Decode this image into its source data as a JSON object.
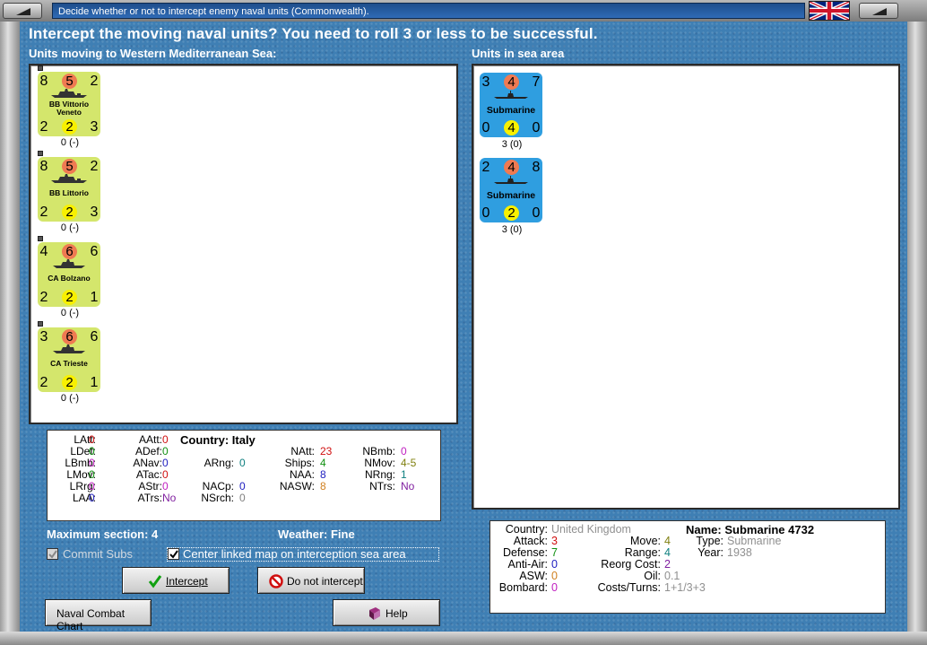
{
  "window": {
    "title": "Decide whether or not to intercept enemy naval units (Commonwealth)."
  },
  "dialog": {
    "headline": "Intercept the moving naval units?  You need to roll 3 or less to be successful.",
    "left_label": "Units moving to Western Mediterranean Sea:",
    "right_label": "Units in sea area"
  },
  "moving_units": [
    {
      "tl": "8",
      "circle": "5",
      "tr": "2",
      "name": "BB Vittorio Veneto",
      "bl": "2",
      "yellow": "2",
      "br": "3",
      "status": "0 (-)"
    },
    {
      "tl": "8",
      "circle": "5",
      "tr": "2",
      "name": "BB Littorio",
      "bl": "2",
      "yellow": "2",
      "br": "3",
      "status": "0 (-)"
    },
    {
      "tl": "4",
      "circle": "6",
      "tr": "6",
      "name": "CA Bolzano",
      "bl": "2",
      "yellow": "2",
      "br": "1",
      "status": "0 (-)"
    },
    {
      "tl": "3",
      "circle": "6",
      "tr": "6",
      "name": "CA Trieste",
      "bl": "2",
      "yellow": "2",
      "br": "1",
      "status": "0 (-)"
    }
  ],
  "sea_units": [
    {
      "tl": "3",
      "circle": "4",
      "tr": "7",
      "name": "Submarine",
      "bl": "0",
      "yellow": "4",
      "br": "0",
      "status": "3 (0)"
    },
    {
      "tl": "2",
      "circle": "4",
      "tr": "8",
      "name": "Submarine",
      "bl": "0",
      "yellow": "2",
      "br": "0",
      "status": "3 (0)"
    }
  ],
  "stats": {
    "country_label": "Country: Italy",
    "col1": [
      {
        "label": "LAtt:",
        "value": "0",
        "color": "#d01010"
      },
      {
        "label": "LDef:",
        "value": "0",
        "color": "#109010"
      },
      {
        "label": "LBmb:",
        "value": "0",
        "color": "#c020c0"
      },
      {
        "label": "LMov:",
        "value": "0",
        "color": "#109010"
      },
      {
        "label": "LRrg:",
        "value": "0",
        "color": "#c020c0"
      },
      {
        "label": "LAA:",
        "value": "0",
        "color": "#2020c0"
      }
    ],
    "col2": [
      {
        "label": "AAtt:",
        "value": "0",
        "color": "#d01010"
      },
      {
        "label": "ADef:",
        "value": "0",
        "color": "#109010"
      },
      {
        "label": "ANav:",
        "value": "0",
        "color": "#2020c0"
      },
      {
        "label": "ATac:",
        "value": "0",
        "color": "#d01010"
      },
      {
        "label": "AStr:",
        "value": "0",
        "color": "#c020c0"
      },
      {
        "label": "ATrs:",
        "value": "No",
        "color": "#8020a0"
      }
    ],
    "col3": [
      {
        "label": "ARng:",
        "value": "0",
        "color": "#108080"
      },
      {
        "label": "NACp:",
        "value": "0",
        "color": "#2020c0"
      },
      {
        "label": "NSrch:",
        "value": "0",
        "color": "#808080"
      }
    ],
    "col4": [
      {
        "label": "NAtt:",
        "value": "23",
        "color": "#d01010"
      },
      {
        "label": "Ships:",
        "value": "4",
        "color": "#109010"
      },
      {
        "label": "NAA:",
        "value": "8",
        "color": "#2020c0"
      },
      {
        "label": "NASW:",
        "value": "8",
        "color": "#d08020"
      }
    ],
    "col5": [
      {
        "label": "NBmb:",
        "value": "0",
        "color": "#c020c0"
      },
      {
        "label": "NMov:",
        "value": "4-5",
        "color": "#808010"
      },
      {
        "label": "NRng:",
        "value": "1",
        "color": "#108080"
      },
      {
        "label": "NTrs:",
        "value": "No",
        "color": "#8020a0"
      }
    ]
  },
  "footer": {
    "max_section": "Maximum section: 4",
    "weather": "Weather:  Fine",
    "commit_subs": "Commit Subs",
    "center_map": "Center linked map on interception sea area",
    "intercept_btn": "Intercept",
    "no_intercept_btn": "Do not intercept",
    "chart_btn": "Naval Combat Chart",
    "help_btn": "Help"
  },
  "detail": {
    "country_label": "Country:",
    "country_value": "United Kingdom",
    "name_line": "Name: Submarine 4732",
    "left": [
      {
        "label": "Attack:",
        "value": "3",
        "color": "#d01010"
      },
      {
        "label": "Defense:",
        "value": "7",
        "color": "#109010"
      },
      {
        "label": "Anti-Air:",
        "value": "0",
        "color": "#2020c0"
      },
      {
        "label": "ASW:",
        "value": "0",
        "color": "#d08020"
      },
      {
        "label": "Bombard:",
        "value": "0",
        "color": "#c020c0"
      }
    ],
    "right": [
      {
        "label": "Move:",
        "value": "4",
        "color": "#808010"
      },
      {
        "label": "Range:",
        "value": "4",
        "color": "#108080"
      },
      {
        "label": "Reorg Cost:",
        "value": "2",
        "color": "#8020a0"
      },
      {
        "label": "Oil:",
        "value": "0.1",
        "color": "#909090"
      },
      {
        "label": "Costs/Turns:",
        "value": "1+1/3+3",
        "color": "#909090"
      }
    ],
    "type_label": "Type:",
    "type_value": "Submarine",
    "year_label": "Year:",
    "year_value": "1938"
  }
}
